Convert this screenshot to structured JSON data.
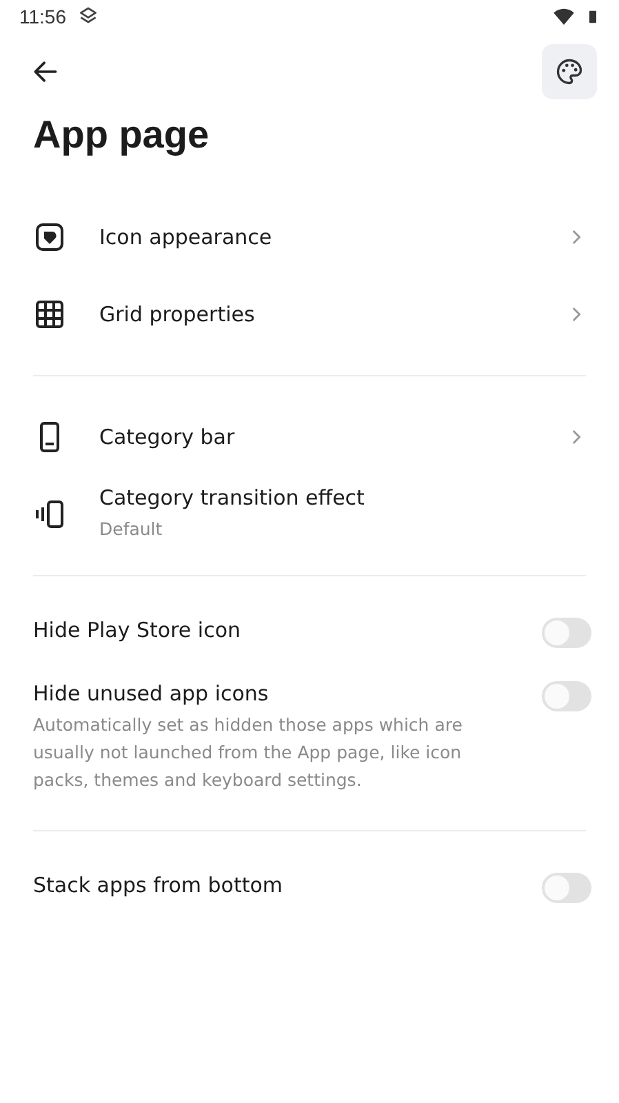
{
  "status_bar": {
    "time": "11:56"
  },
  "title": "App page",
  "groups": [
    {
      "items": [
        {
          "kind": "nav",
          "label": "Icon appearance",
          "chevron": true
        },
        {
          "kind": "nav",
          "label": "Grid properties",
          "chevron": true
        }
      ]
    },
    {
      "items": [
        {
          "kind": "nav",
          "label": "Category bar",
          "chevron": true
        },
        {
          "kind": "nav",
          "label": "Category transition effect",
          "subtitle": "Default",
          "chevron": false
        }
      ]
    },
    {
      "items": [
        {
          "kind": "toggle",
          "label": "Hide Play Store icon",
          "on": false
        },
        {
          "kind": "toggle",
          "label": "Hide unused app icons",
          "subtitle": "Automatically set as hidden those apps which are usually not launched from the App page, like icon packs, themes and keyboard settings.",
          "on": false
        }
      ]
    },
    {
      "items": [
        {
          "kind": "toggle",
          "label": "Stack apps from bottom",
          "on": false
        }
      ]
    }
  ]
}
